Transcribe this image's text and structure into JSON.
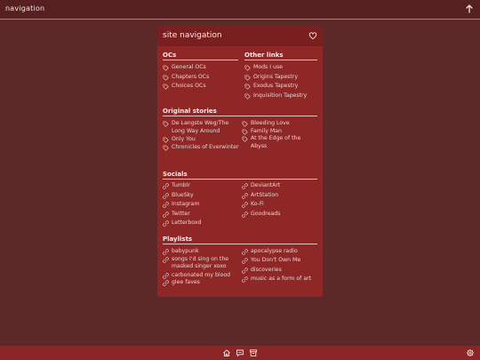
{
  "topbar": {
    "title": "navigation",
    "up_icon": "arrow-up-icon"
  },
  "panel": {
    "title": "site navigation",
    "heart_icon": "heart-icon",
    "sections": {
      "ocs": {
        "title": "OCs",
        "items": [
          "General OCs",
          "Chapters OCs",
          "Choices OCs"
        ]
      },
      "other_links": {
        "title": "Other links",
        "items": [
          "Mods I use",
          "Origins Tapestry",
          "Exodus Tapestry",
          "Inquisition Tapestry"
        ]
      },
      "original_stories": {
        "title": "Original stories",
        "left": [
          "De Langste Weg/The Long Way Around",
          "Only You",
          "Chronicles of Everwinter"
        ],
        "right": [
          "Bleeding Love",
          "Family Man",
          "At the Edge of the Abyss"
        ]
      },
      "socials": {
        "title": "Socials",
        "left": [
          "Tumblr",
          "BlueSky",
          "Instagram",
          "Twitter",
          "Letterboxd"
        ],
        "right": [
          "DeviantArt",
          "ArtStation",
          "Ko-Fi",
          "Goodreads"
        ]
      },
      "playlists": {
        "title": "Playlists",
        "left": [
          "babypunk",
          "songs I'd sing on the masked singer xoxo",
          "carbonated my blood",
          "glee faves"
        ],
        "right": [
          "apocalypse radio",
          "You Don't Own Me",
          "discoveries",
          "music as a form of art"
        ]
      }
    }
  },
  "bottombar": {
    "icons": [
      "home-icon",
      "chat-bubble-icon",
      "archive-icon",
      "settings-icon"
    ]
  }
}
